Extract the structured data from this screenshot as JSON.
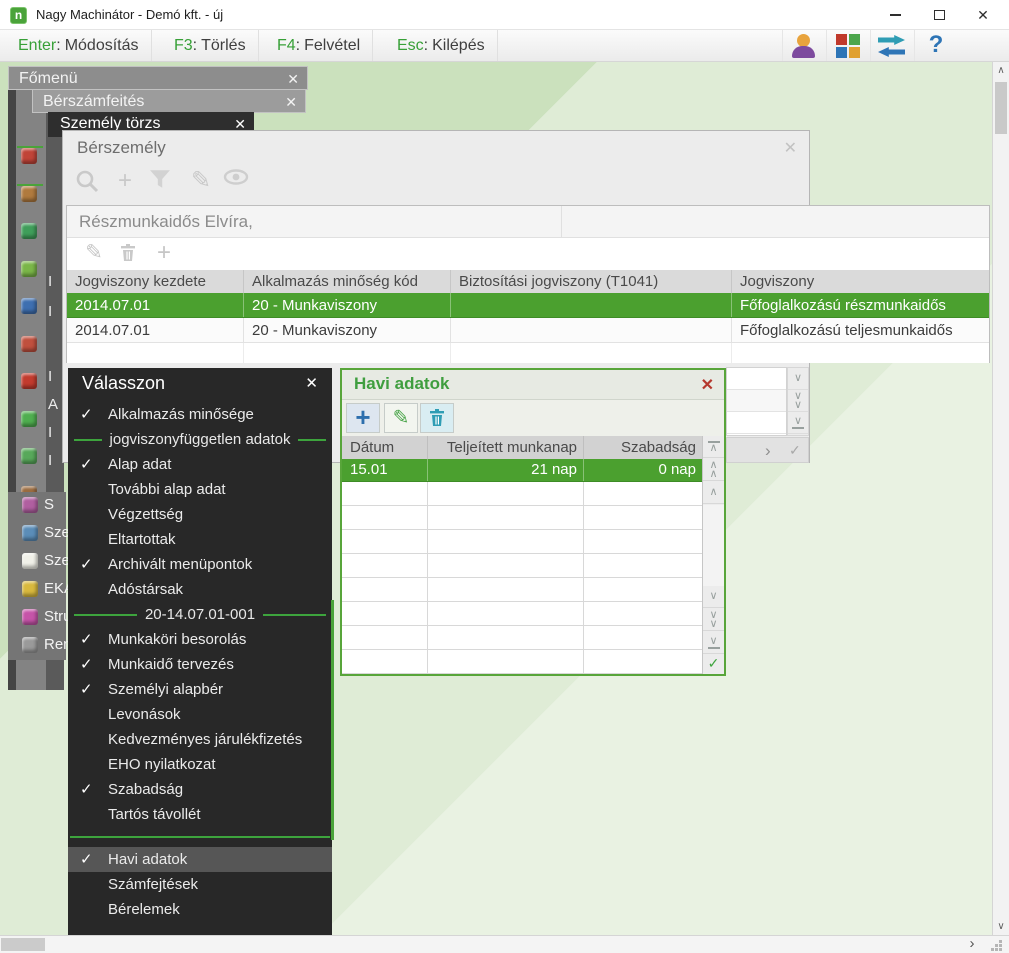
{
  "titlebar": {
    "app_title": "Nagy Machinátor - Demó kft. - új",
    "logo_letter": "n"
  },
  "toolbar": {
    "items": [
      {
        "key": "Enter",
        "label": "Módosítás"
      },
      {
        "key": "F3",
        "label": "Törlés"
      },
      {
        "key": "F4",
        "label": "Felvétel"
      },
      {
        "key": "Esc",
        "label": "Kilépés"
      }
    ]
  },
  "cascade": {
    "fomenu_title": "Főmenü",
    "berszamfejtes_title": "Bérszámfeités",
    "szemelytorzs_title": "Személy törzs"
  },
  "sidebar": {
    "partial_letters": [
      "I",
      "I",
      "I",
      "A",
      "I",
      "I"
    ],
    "menu_items": [
      {
        "label": "S"
      },
      {
        "label": "Sze"
      },
      {
        "label": "Sze"
      },
      {
        "label": "EKÁ"
      },
      {
        "label": "Stru"
      },
      {
        "label": "Ren"
      }
    ]
  },
  "berszemely": {
    "title": "Bérszemély",
    "person_name": "Részmunkaidős Elvíra,"
  },
  "jogviszony_table": {
    "columns": [
      "Jogviszony kezdete",
      "Alkalmazás minőség kód",
      "Biztosítási jogviszony (T1041)",
      "Jogviszony"
    ],
    "rows": [
      {
        "kezdete": "2014.07.01",
        "minoseg": "20 - Munkaviszony",
        "biztositasi": "",
        "jogviszony": "Főfoglalkozású részmunkaidős",
        "selected": true
      },
      {
        "kezdete": "2014.07.01",
        "minoseg": "20 - Munkaviszony",
        "biztositasi": "",
        "jogviszony": "Főfoglalkozású teljesmunkaidős",
        "selected": false
      }
    ]
  },
  "valasszon": {
    "title": "Válasszon",
    "items": [
      {
        "type": "item",
        "label": "Alkalmazás minősége",
        "checked": true
      },
      {
        "type": "separator",
        "label": "jogviszonyfüggetlen adatok"
      },
      {
        "type": "item",
        "label": "Alap adat",
        "checked": true
      },
      {
        "type": "item",
        "label": "További alap adat",
        "checked": false
      },
      {
        "type": "item",
        "label": "Végzettség",
        "checked": false
      },
      {
        "type": "item",
        "label": "Eltartottak",
        "checked": false
      },
      {
        "type": "item",
        "label": "Archivált menüpontok",
        "checked": true
      },
      {
        "type": "item",
        "label": "Adóstársak",
        "checked": false
      },
      {
        "type": "separator",
        "label": "20-14.07.01-001"
      },
      {
        "type": "item",
        "label": "Munkaköri besorolás",
        "checked": true
      },
      {
        "type": "item",
        "label": "Munkaidő tervezés",
        "checked": true
      },
      {
        "type": "item",
        "label": "Személyi alapbér",
        "checked": true
      },
      {
        "type": "item",
        "label": "Levonások",
        "checked": false
      },
      {
        "type": "item",
        "label": "Kedvezményes járulékfizetés",
        "checked": false
      },
      {
        "type": "item",
        "label": "EHO nyilatkozat",
        "checked": false
      },
      {
        "type": "item",
        "label": "Szabadság",
        "checked": true
      },
      {
        "type": "item",
        "label": "Tartós távollét",
        "checked": false
      },
      {
        "type": "line"
      },
      {
        "type": "item",
        "label": "Havi adatok",
        "checked": true,
        "highlighted": true
      },
      {
        "type": "item",
        "label": "Számfejtések",
        "checked": false
      },
      {
        "type": "item",
        "label": "Bérelemek",
        "checked": false
      }
    ]
  },
  "havi_adatok": {
    "title": "Havi adatok",
    "columns": [
      "Dátum",
      "Teljeített munkanap",
      "Szabadság"
    ],
    "row": {
      "datum": "15.01",
      "munkanap": "21 nap",
      "szabadsag": "0 nap"
    },
    "empty_row_count": 8
  },
  "colors": {
    "accent_green": "#4ba02f",
    "separator_green": "#3da43d",
    "key_green": "#38a038",
    "close_red": "#b5382e",
    "panel_dark": "#282828",
    "desktop_green": "#dfecd6"
  }
}
